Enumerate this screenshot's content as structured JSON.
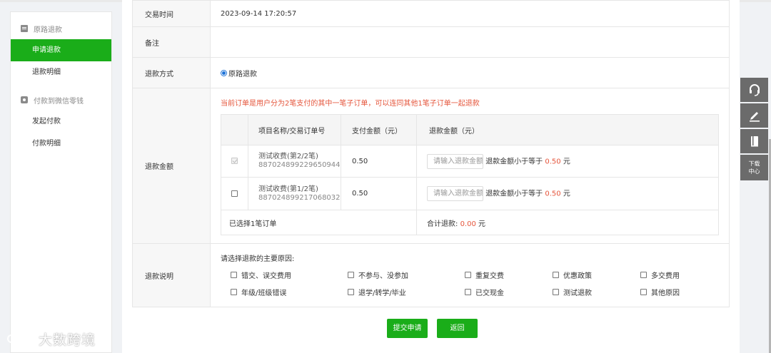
{
  "sidebar": {
    "group1": {
      "label": "原路退款",
      "icon": "document-icon"
    },
    "items1": [
      {
        "label": "申请退款",
        "active": true
      },
      {
        "label": "退款明细",
        "active": false
      }
    ],
    "group2": {
      "label": "付款到微信零钱",
      "icon": "wallet-icon"
    },
    "items2": [
      {
        "label": "发起付款"
      },
      {
        "label": "付款明细"
      }
    ]
  },
  "form": {
    "trade_time": {
      "label": "交易时间",
      "value": "2023-09-14 17:20:57"
    },
    "remark": {
      "label": "备注",
      "value": ""
    },
    "refund_method": {
      "label": "退款方式",
      "option": "原路退款",
      "selected": true
    },
    "refund_amount": {
      "label": "退款金额",
      "notice": "当前订单是用户分为2笔支付的其中一笔子订单，可以连同其他1笔子订单一起退款",
      "headers": {
        "item": "项目名称/交易订单号",
        "paid": "支付金额（元）",
        "refund": "退款金额（元）"
      },
      "rows": [
        {
          "name": "测试收费(第2/2笔)",
          "order_no": "887024899229650944",
          "paid": "0.50",
          "placeholder": "请输入退款金额",
          "hint_prefix": "退款金额小于等于",
          "max": "0.50",
          "unit": "元",
          "checked": true,
          "disabled": true
        },
        {
          "name": "测试收费(第1/2笔)",
          "order_no": "887024899217068032",
          "paid": "0.50",
          "placeholder": "请输入退款金额",
          "hint_prefix": "退款金额小于等于",
          "max": "0.50",
          "unit": "元",
          "checked": false,
          "disabled": false
        }
      ],
      "footer": {
        "selected_text": "已选择1笔订单",
        "total_label": "合计退款:",
        "total_value": "0.00",
        "unit": "元"
      }
    },
    "refund_reason": {
      "label": "退款说明",
      "prompt": "请选择退款的主要原因:",
      "options": [
        "错交、误交费用",
        "不参与、没参加",
        "重复交费",
        "优惠政策",
        "多交费用",
        "年级/班级错误",
        "退学/转学/毕业",
        "已交现金",
        "测试退款",
        "其他原因"
      ]
    }
  },
  "buttons": {
    "submit": "提交申请",
    "back": "返回"
  },
  "tools": {
    "download": "下载中心",
    "download_line1": "下载",
    "download_line2": "中心"
  },
  "watermark": "大数跨境",
  "colors": {
    "accent": "#1aad19",
    "warning": "#e5553b",
    "tool_bg": "#6b6b6b"
  }
}
